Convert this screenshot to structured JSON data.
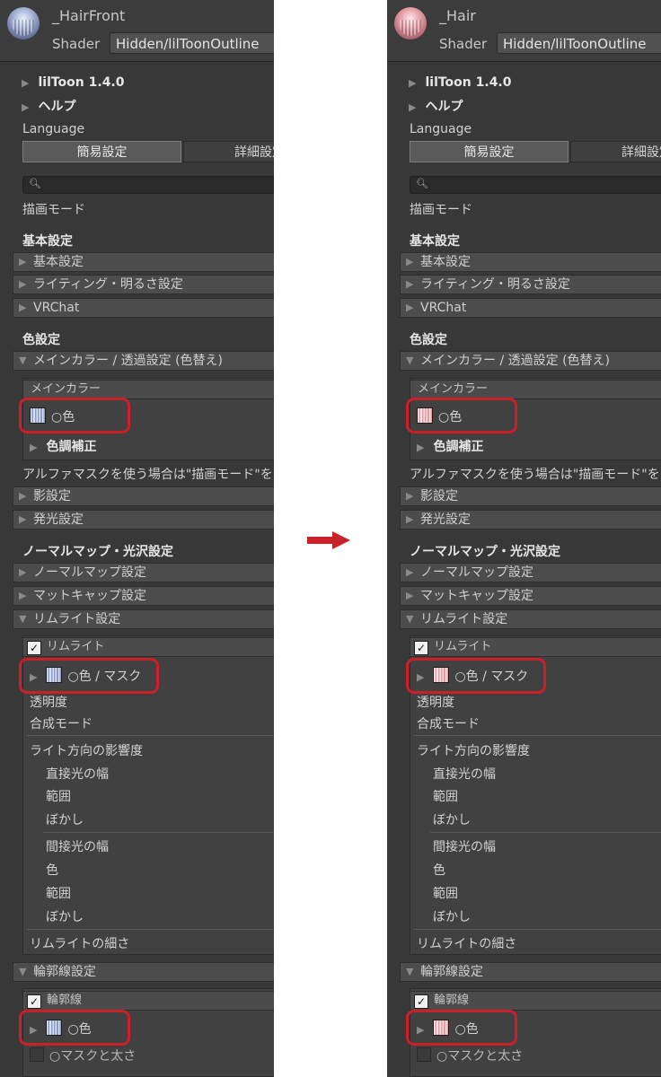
{
  "panels": [
    {
      "material_name": "_HairFront",
      "shader_label": "Shader",
      "shader_value": "Hidden/lilToonOutline",
      "thumb_tint": "blue",
      "version": "lilToon 1.4.0",
      "help": "ヘルプ",
      "language_label": "Language",
      "tab_simple": "簡易設定",
      "tab_detail": "詳細設定",
      "render_mode": "描画モード",
      "basic_section": "基本設定",
      "basic_foldout": "基本設定",
      "lighting_foldout": "ライティング・明るさ設定",
      "vrchat_foldout": "VRChat",
      "color_section": "色設定",
      "main_color_foldout": "メインカラー / 透過設定 (色替え)",
      "main_color_sub": "メインカラー",
      "color_prop": "○色",
      "color_adjust": "色調補正",
      "alpha_note": "アルファマスクを使う場合は\"描画モード\"をカットアウトに",
      "shadow_foldout": "影設定",
      "emission_foldout": "発光設定",
      "normal_section": "ノーマルマップ・光沢設定",
      "normalmap_foldout": "ノーマルマップ設定",
      "matcap_foldout": "マットキャップ設定",
      "rim_foldout": "リムライト設定",
      "rim_toggle": "リムライト",
      "rim_color": "○色 / マスク",
      "transparency": "透明度",
      "blend_mode": "合成モード",
      "light_dir": "ライト方向の影響度",
      "direct_width": "直接光の幅",
      "range1": "範囲",
      "blur1": "ぼかし",
      "indirect_width": "間接光の幅",
      "color_label": "色",
      "range2": "範囲",
      "blur2": "ぼかし",
      "rim_thickness": "リムライトの細さ",
      "outline_foldout": "輪郭線設定",
      "outline_toggle": "輪郭線",
      "outline_color": "○色",
      "outline_mask": "○マスクと太さ"
    },
    {
      "material_name": "_Hair",
      "shader_label": "Shader",
      "shader_value": "Hidden/lilToonOutline",
      "thumb_tint": "pink",
      "version": "lilToon 1.4.0",
      "help": "ヘルプ",
      "language_label": "Language",
      "tab_simple": "簡易設定",
      "tab_detail": "詳細設定",
      "render_mode": "描画モード",
      "basic_section": "基本設定",
      "basic_foldout": "基本設定",
      "lighting_foldout": "ライティング・明るさ設定",
      "vrchat_foldout": "VRChat",
      "color_section": "色設定",
      "main_color_foldout": "メインカラー / 透過設定 (色替え)",
      "main_color_sub": "メインカラー",
      "color_prop": "○色",
      "color_adjust": "色調補正",
      "alpha_note": "アルファマスクを使う場合は\"描画モード\"をカットアウトに",
      "shadow_foldout": "影設定",
      "emission_foldout": "発光設定",
      "normal_section": "ノーマルマップ・光沢設定",
      "normalmap_foldout": "ノーマルマップ設定",
      "matcap_foldout": "マットキャップ設定",
      "rim_foldout": "リムライト設定",
      "rim_toggle": "リムライト",
      "rim_color": "○色 / マスク",
      "transparency": "透明度",
      "blend_mode": "合成モード",
      "light_dir": "ライト方向の影響度",
      "direct_width": "直接光の幅",
      "range1": "範囲",
      "blur1": "ぼかし",
      "indirect_width": "間接光の幅",
      "color_label": "色",
      "range2": "範囲",
      "blur2": "ぼかし",
      "rim_thickness": "リムライトの細さ",
      "outline_foldout": "輪郭線設定",
      "outline_toggle": "輪郭線",
      "outline_color": "○色",
      "outline_mask": "○マスクと太さ"
    }
  ],
  "colors": {
    "highlight": "#cc1f28",
    "arrow": "#c8232b",
    "panel_bg": "#383838"
  }
}
